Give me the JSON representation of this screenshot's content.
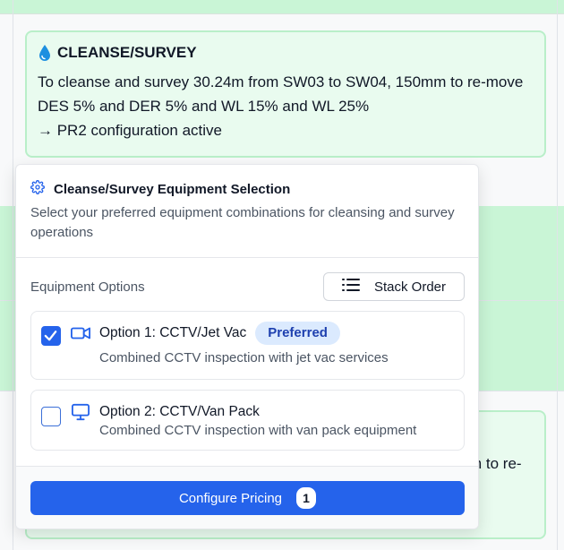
{
  "cleanse": {
    "title": "CLEANSE/SURVEY",
    "description": "To cleanse and survey 30.24m from SW03 to SW04, 150mm to re-move DES 5% and DER 5% and WL 15% and WL 25%",
    "config_status": "→ PR2 configuration active"
  },
  "second_card": {
    "partial_text": "m to re-"
  },
  "popover": {
    "title": "Cleanse/Survey Equipment Selection",
    "subtitle": "Select your preferred equipment combinations for cleansing and survey operations",
    "options_label": "Equipment Options",
    "stack_order_label": "Stack Order",
    "options": [
      {
        "title": "Option 1: CCTV/Jet Vac",
        "badge": "Preferred",
        "description": "Combined CCTV inspection with jet vac services",
        "checked": true,
        "icon": "video-camera-icon"
      },
      {
        "title": "Option 2: CCTV/Van Pack",
        "description": "Combined CCTV inspection with van pack equipment",
        "checked": false,
        "icon": "monitor-icon"
      }
    ],
    "configure_label": "Configure Pricing",
    "configure_count": "1"
  },
  "colors": {
    "accent": "#2563eb",
    "green_bg": "#e9fbef",
    "green_border": "#b9efc9",
    "badge_bg": "#dbeafe",
    "badge_text": "#1e40af"
  }
}
